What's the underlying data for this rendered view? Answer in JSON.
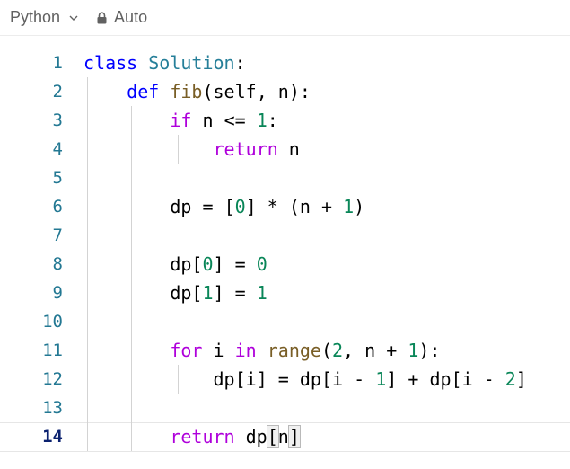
{
  "toolbar": {
    "language": "Python",
    "mode": "Auto"
  },
  "icons": {
    "language_dropdown": "chevron-down-icon",
    "mode": "lock-icon"
  },
  "colors": {
    "keyword_control": "#af00db",
    "keyword": "#0000ff",
    "class_name": "#267f99",
    "function_name": "#795e26",
    "number": "#098658",
    "line_number": "#237893",
    "active_line_number": "#0b216f"
  },
  "editor": {
    "active_line": 14,
    "lines": [
      {
        "n": "1",
        "text": "class Solution:"
      },
      {
        "n": "2",
        "text": "    def fib(self, n):"
      },
      {
        "n": "3",
        "text": "        if n <= 1:"
      },
      {
        "n": "4",
        "text": "            return n"
      },
      {
        "n": "5",
        "text": ""
      },
      {
        "n": "6",
        "text": "        dp = [0] * (n + 1)"
      },
      {
        "n": "7",
        "text": ""
      },
      {
        "n": "8",
        "text": "        dp[0] = 0"
      },
      {
        "n": "9",
        "text": "        dp[1] = 1"
      },
      {
        "n": "10",
        "text": ""
      },
      {
        "n": "11",
        "text": "        for i in range(2, n + 1):"
      },
      {
        "n": "12",
        "text": "            dp[i] = dp[i - 1] + dp[i - 2]"
      },
      {
        "n": "13",
        "text": ""
      },
      {
        "n": "14",
        "text": "        return dp[n]"
      }
    ]
  }
}
